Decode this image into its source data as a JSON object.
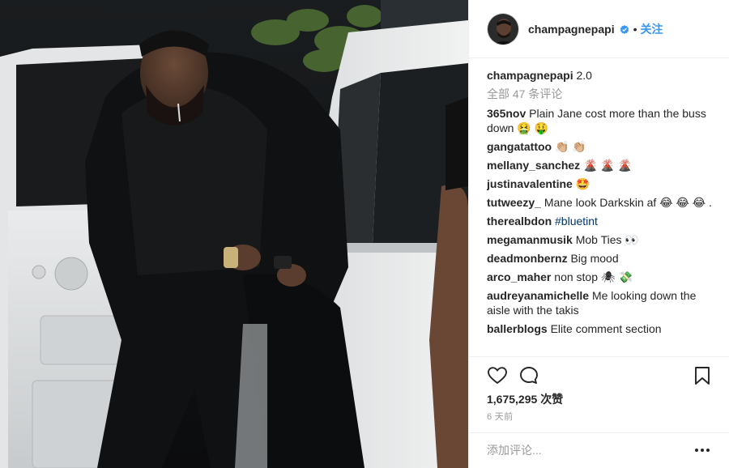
{
  "post": {
    "author": "champagnepapi",
    "follow_label": "关注",
    "separator": "•",
    "caption_user": "champagnepapi",
    "caption_text": "2.0",
    "load_all_label": "全部 47 条评论",
    "likes_count": "1,675,295",
    "likes_suffix": "次赞",
    "time_ago": "6 天前",
    "comment_placeholder": "添加评论..."
  },
  "comments": [
    {
      "user": "365nov",
      "text": "Plain Jane cost more than the buss down 🤮 🤑"
    },
    {
      "user": "gangatattoo",
      "text": "👏🏼 👏🏼"
    },
    {
      "user": "mellany_sanchez",
      "text": "🌋 🌋 🌋"
    },
    {
      "user": "justinavalentine",
      "text": "🤩"
    },
    {
      "user": "tutweezy_",
      "text": "Mane look Darkskin af 😂 😂 😂 ."
    },
    {
      "user": "therealbdon",
      "text": "#bluetint",
      "hashtag": true
    },
    {
      "user": "megamanmusik",
      "text": "Mob Ties 👀"
    },
    {
      "user": "deadmonbernz",
      "text": "Big mood"
    },
    {
      "user": "arco_maher",
      "text": "non stop 🕷 💸"
    },
    {
      "user": "audreyanamichelle",
      "text": "Me looking down the aisle with the takis"
    },
    {
      "user": "ballerblogs",
      "text": "Elite comment section"
    }
  ],
  "icons": {
    "like": "heart-icon",
    "comment": "comment-bubble-icon",
    "save": "bookmark-icon",
    "more": "more-dots-icon",
    "verified": "verified-badge-icon"
  },
  "colors": {
    "accent": "#3897f0",
    "hashtag": "#003569",
    "muted": "#999999",
    "text": "#262626"
  }
}
